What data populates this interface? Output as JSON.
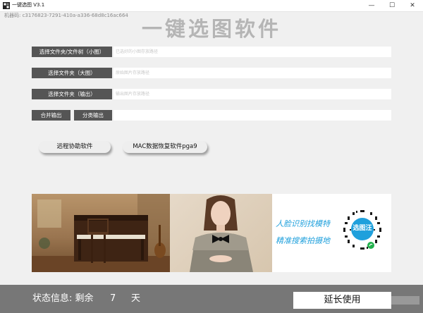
{
  "window": {
    "title": "一键选图 V3.1",
    "buttons": {
      "minimize": "—",
      "maximize": "☐",
      "close": "✕"
    }
  },
  "machine_code": "机器码: c3176823-7291-410a-a336-68d8c16ac664",
  "app_title": "一键选图软件",
  "rows": [
    {
      "label": "选择文件夹/文件树（小图）",
      "placeholder": "已选好的小图存放路径",
      "value": ""
    },
    {
      "label": "选择文件夹（大图）",
      "placeholder": "原始图片存放路径",
      "value": ""
    },
    {
      "label": "选择文件夹（输出）",
      "placeholder": "输出图片存放路径",
      "value": ""
    }
  ],
  "output_row": {
    "merge_label": "合并输出",
    "classify_label": "分类输出",
    "value": ""
  },
  "remote_button": "远程协助软件",
  "mac_button": "MAC数据恢复软件pga9",
  "banner": {
    "promo_line1": "人脸识别找模特",
    "promo_line2": "精准搜索拍摄地",
    "qr_badge": "选图汪",
    "icons": [
      "piano-photo",
      "model-photo",
      "qr-code",
      "wechat-mini-program-icon"
    ]
  },
  "status": {
    "label": "状态信息: 剩余",
    "days": "7",
    "unit": "天"
  },
  "extend_button": "延长使用",
  "colors": {
    "dark_button": "#555555",
    "status_bar": "#777777",
    "promo_blue": "#1fa0dc",
    "title_gray": "#b5b5b5"
  }
}
